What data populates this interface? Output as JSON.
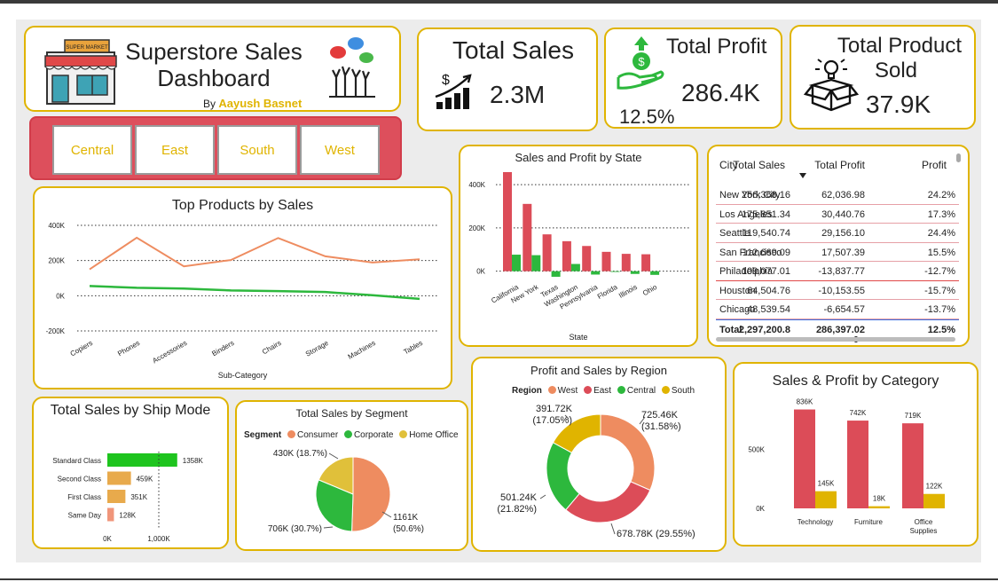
{
  "header": {
    "title_line1": "Superstore Sales",
    "title_line2": "Dashboard",
    "byline_prefix": "By",
    "author": "Aayush Basnet",
    "store_sign": "SUPER MARKET"
  },
  "kpis": {
    "total_sales": {
      "title": "Total Sales",
      "value": "2.3M",
      "icon": "sales-growth-icon"
    },
    "total_profit": {
      "title": "Total Profit",
      "value": "286.4K",
      "margin": "12.5%",
      "icon": "money-hand-icon"
    },
    "total_product": {
      "title_line1": "Total Product",
      "title_line2": "Sold",
      "value": "37.9K",
      "icon": "idea-box-icon"
    }
  },
  "slicer": {
    "items": [
      "Central",
      "East",
      "South",
      "West"
    ]
  },
  "colors": {
    "accent": "#e0b400",
    "red": "#dc4c58",
    "green": "#2db83d",
    "orange": "#ee8c60",
    "gold": "#e0b400",
    "bar_orange": "#e8aa4c",
    "ship_green": "#1ec41e",
    "ship_orange": "#e8aa4c",
    "ship_salmon": "#f0957a"
  },
  "chart_data": [
    {
      "id": "top_products",
      "type": "line",
      "title": "Top Products by Sales",
      "xlabel": "Sub-Category",
      "categories": [
        "Copiers",
        "Phones",
        "Accessories",
        "Binders",
        "Chairs",
        "Storage",
        "Machines",
        "Tables"
      ],
      "yticks": [
        "400K",
        "200K",
        "0K",
        "-200K"
      ],
      "ytick_values": [
        400000,
        200000,
        0,
        -200000
      ],
      "ylim": [
        -200000,
        400000
      ],
      "series": [
        {
          "values": [
            150000,
            330000,
            167000,
            203000,
            328000,
            224000,
            189000,
            207000
          ]
        },
        {
          "values": [
            55000,
            45000,
            41000,
            30000,
            26000,
            21000,
            3000,
            -18000
          ]
        }
      ]
    },
    {
      "id": "state",
      "type": "bar",
      "title": "Sales and Profit by State",
      "xlabel": "State",
      "categories": [
        "California",
        "New York",
        "Texas",
        "Washington",
        "Pennsylvania",
        "Florida",
        "Illinois",
        "Ohio"
      ],
      "yticks": [
        "400K",
        "200K",
        "0K"
      ],
      "ytick_values": [
        400000,
        200000,
        0
      ],
      "ylim": [
        -30000,
        470000
      ],
      "series": [
        {
          "values": [
            457688,
            310876,
            170188,
            138641,
            116512,
            89474,
            80166,
            78258
          ]
        },
        {
          "values": [
            76381,
            74039,
            -25729,
            33403,
            -15560,
            -3399,
            -12608,
            -16971
          ]
        }
      ]
    },
    {
      "id": "city_table",
      "type": "table",
      "columns": [
        "City",
        "Total Sales",
        "Total Profit",
        "Profit"
      ],
      "rows": [
        [
          "New York City",
          "256,368.16",
          "62,036.98",
          "24.2%"
        ],
        [
          "Los Angeles",
          "175,851.34",
          "30,440.76",
          "17.3%"
        ],
        [
          "Seattle",
          "119,540.74",
          "29,156.10",
          "24.4%"
        ],
        [
          "San Francisco",
          "112,669.09",
          "17,507.39",
          "15.5%"
        ],
        [
          "Philadelphia",
          "109,077.01",
          "-13,837.77",
          "-12.7%"
        ],
        [
          "Houston",
          "64,504.76",
          "-10,153.55",
          "-15.7%"
        ],
        [
          "Chicago",
          "48,539.54",
          "-6,654.57",
          "-13.7%"
        ]
      ],
      "total": [
        "Total",
        "2,297,200.8",
        "286,397.02",
        "12.5%"
      ],
      "total_sales_wrap": "6"
    },
    {
      "id": "ship_mode",
      "type": "bar",
      "title": "Total Sales by Ship Mode",
      "categories": [
        "Standard Class",
        "Second Class",
        "First Class",
        "Same Day"
      ],
      "values": [
        1358000,
        459000,
        351000,
        128000
      ],
      "labels": [
        "1358K",
        "459K",
        "351K",
        "128K"
      ],
      "xticks": [
        "0K",
        "1,000K"
      ],
      "xlim": [
        0,
        1000000
      ]
    },
    {
      "id": "segment",
      "type": "pie",
      "title": "Total Sales by Segment",
      "legend_title": "Segment",
      "categories": [
        "Consumer",
        "Corporate",
        "Home Office"
      ],
      "values": [
        1161000,
        706000,
        430000
      ],
      "labels": [
        "1161K",
        "706K (30.7%)",
        "430K (18.7%)"
      ],
      "label_extra": [
        "(50.6%)",
        "",
        ""
      ]
    },
    {
      "id": "region",
      "type": "pie",
      "title": "Profit and Sales by Region",
      "legend_title": "Region",
      "categories": [
        "West",
        "East",
        "Central",
        "South"
      ],
      "values": [
        725460,
        678780,
        501240,
        391720
      ],
      "labels": [
        "725.46K",
        "678.78K (29.55%)",
        "501.24K",
        "391.72K"
      ],
      "label_pct": [
        "(31.58%)",
        "",
        "(21.82%)",
        "(17.05%)"
      ]
    },
    {
      "id": "category",
      "type": "bar",
      "title": "Sales & Profit by Category",
      "categories": [
        "Technology",
        "Furniture",
        "Office Supplies"
      ],
      "category_lines": [
        [
          "Technology"
        ],
        [
          "Furniture"
        ],
        [
          "Office",
          "Supplies"
        ]
      ],
      "yticks": [
        "500K",
        "0K"
      ],
      "ytick_values": [
        500000,
        0
      ],
      "ylim": [
        0,
        900000
      ],
      "series": [
        {
          "values": [
            836000,
            742000,
            719000
          ],
          "labels": [
            "836K",
            "742K",
            "719K"
          ]
        },
        {
          "values": [
            145000,
            18000,
            122000
          ],
          "labels": [
            "145K",
            "18K",
            "122K"
          ]
        }
      ]
    }
  ]
}
